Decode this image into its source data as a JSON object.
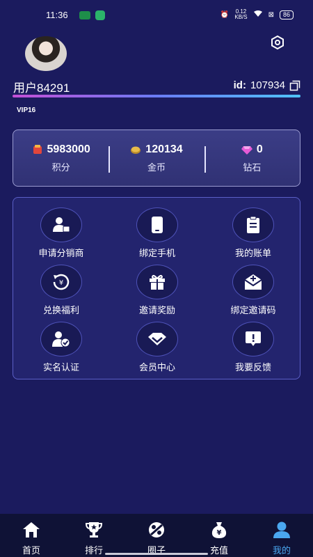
{
  "status": {
    "time": "11:36",
    "speed_value": "0.12",
    "speed_unit": "KB/S",
    "battery": "86"
  },
  "profile": {
    "username": "用户84291",
    "id_label": "id:",
    "id_value": "107934",
    "vip": "VIP16",
    "level_progress": 1.0
  },
  "stats": [
    {
      "value": "5983000",
      "label": "积分",
      "icon": "points-icon"
    },
    {
      "value": "120134",
      "label": "金币",
      "icon": "gold-coin-icon"
    },
    {
      "value": "0",
      "label": "钻石",
      "icon": "diamond-icon"
    }
  ],
  "menu": [
    {
      "label": "申请分销商",
      "icon": "distributor-icon"
    },
    {
      "label": "绑定手机",
      "icon": "phone-icon"
    },
    {
      "label": "我的账单",
      "icon": "bill-icon"
    },
    {
      "label": "兑换福利",
      "icon": "exchange-icon"
    },
    {
      "label": "邀请奖励",
      "icon": "gift-icon"
    },
    {
      "label": "绑定邀请码",
      "icon": "invite-code-icon"
    },
    {
      "label": "实名认证",
      "icon": "verify-icon"
    },
    {
      "label": "会员中心",
      "icon": "vip-center-icon"
    },
    {
      "label": "我要反馈",
      "icon": "feedback-icon"
    }
  ],
  "tabs": [
    {
      "label": "首页",
      "icon": "home-icon"
    },
    {
      "label": "排行",
      "icon": "trophy-icon"
    },
    {
      "label": "圈子",
      "icon": "circle-icon"
    },
    {
      "label": "充值",
      "icon": "recharge-icon"
    },
    {
      "label": "我的",
      "icon": "profile-icon",
      "active": true
    }
  ],
  "colors": {
    "background": "#1b1b5e",
    "accent": "#4aa7f0"
  }
}
